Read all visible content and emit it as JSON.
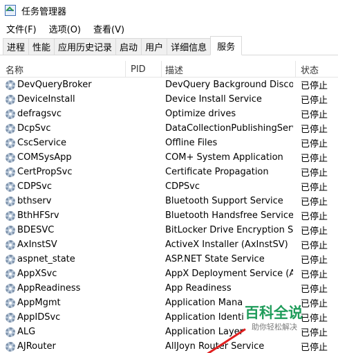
{
  "window": {
    "title": "任务管理器"
  },
  "menu": [
    "文件(F)",
    "选项(O)",
    "查看(V)"
  ],
  "tabs": [
    "进程",
    "性能",
    "应用历史记录",
    "启动",
    "用户",
    "详细信息",
    "服务"
  ],
  "active_tab": "服务",
  "columns": {
    "name": "名称",
    "pid": "PID",
    "desc": "描述",
    "status": "状态"
  },
  "services": [
    {
      "name": "DevQueryBroker",
      "pid": "",
      "desc": "DevQuery Background Disco...",
      "status": "已停止"
    },
    {
      "name": "DeviceInstall",
      "pid": "",
      "desc": "Device Install Service",
      "status": "已停止"
    },
    {
      "name": "defragsvc",
      "pid": "",
      "desc": "Optimize drives",
      "status": "已停止"
    },
    {
      "name": "DcpSvc",
      "pid": "",
      "desc": "DataCollectionPublishingServi...",
      "status": "已停止"
    },
    {
      "name": "CscService",
      "pid": "",
      "desc": "Offline Files",
      "status": "已停止"
    },
    {
      "name": "COMSysApp",
      "pid": "",
      "desc": "COM+ System Application",
      "status": "已停止"
    },
    {
      "name": "CertPropSvc",
      "pid": "",
      "desc": "Certificate Propagation",
      "status": "已停止"
    },
    {
      "name": "CDPSvc",
      "pid": "",
      "desc": "CDPSvc",
      "status": "已停止"
    },
    {
      "name": "bthserv",
      "pid": "",
      "desc": "Bluetooth Support Service",
      "status": "已停止"
    },
    {
      "name": "BthHFSrv",
      "pid": "",
      "desc": "Bluetooth Handsfree Service",
      "status": "已停止"
    },
    {
      "name": "BDESVC",
      "pid": "",
      "desc": "BitLocker Drive Encryption Se...",
      "status": "已停止"
    },
    {
      "name": "AxInstSV",
      "pid": "",
      "desc": "ActiveX Installer (AxInstSV)",
      "status": "已停止"
    },
    {
      "name": "aspnet_state",
      "pid": "",
      "desc": "ASP.NET State Service",
      "status": "已停止"
    },
    {
      "name": "AppXSvc",
      "pid": "",
      "desc": "AppX Deployment Service (A...",
      "status": "已停止"
    },
    {
      "name": "AppReadiness",
      "pid": "",
      "desc": "App Readiness",
      "status": "已停止"
    },
    {
      "name": "AppMgmt",
      "pid": "",
      "desc": "Application Mana",
      "status": "已停止"
    },
    {
      "name": "AppIDSvc",
      "pid": "",
      "desc": "Application Identi",
      "status": "已停止"
    },
    {
      "name": "ALG",
      "pid": "",
      "desc": "Application Layer",
      "status": "已停止"
    },
    {
      "name": "AJRouter",
      "pid": "",
      "desc": "AllJoyn Router Service",
      "status": "已停止"
    }
  ],
  "watermark": {
    "title": "百科全说",
    "subtitle": "助你轻松解决"
  },
  "colors": {
    "gear_icon": "#7a8fa8",
    "watermark_green": "#1f9c5a",
    "arrow_red": "#e02020"
  }
}
